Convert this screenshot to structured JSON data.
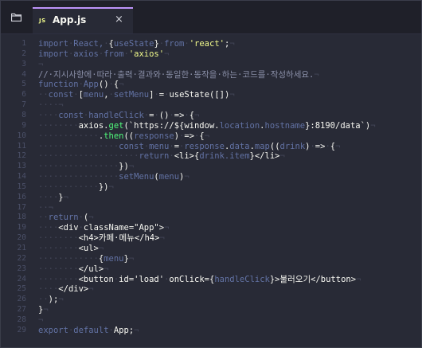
{
  "tab": {
    "js_badge": "JS",
    "file_name": "App.js",
    "close_glyph": "×"
  },
  "code_lines": [
    {
      "num": "1",
      "segments": [
        [
          "kw",
          "import"
        ],
        [
          "ws",
          "·"
        ],
        [
          "kw",
          "React,"
        ],
        [
          "ws",
          "·"
        ],
        [
          "pn",
          "{"
        ],
        [
          "kw",
          "useState"
        ],
        [
          "pn",
          "}"
        ],
        [
          "ws",
          "·"
        ],
        [
          "kw",
          "from"
        ],
        [
          "ws",
          "·"
        ],
        [
          "st",
          "'react'"
        ],
        [
          "pn",
          ";"
        ],
        [
          "ws",
          "¬"
        ]
      ]
    },
    {
      "num": "2",
      "segments": [
        [
          "kw",
          "import"
        ],
        [
          "ws",
          "·"
        ],
        [
          "kw",
          "axios"
        ],
        [
          "ws",
          "·"
        ],
        [
          "kw",
          "from"
        ],
        [
          "ws",
          "·"
        ],
        [
          "st",
          "'axios'"
        ],
        [
          "ws",
          "¬"
        ]
      ]
    },
    {
      "num": "3",
      "segments": [
        [
          "ws",
          "¬"
        ]
      ]
    },
    {
      "num": "4",
      "segments": [
        [
          "cm",
          "//·지시사항에·따라·출력·결과와·동일한·동작을·하는·코드를·작성하세요."
        ],
        [
          "ws",
          "¬"
        ]
      ]
    },
    {
      "num": "5",
      "segments": [
        [
          "kw",
          "function"
        ],
        [
          "ws",
          "·"
        ],
        [
          "kw",
          "App"
        ],
        [
          "pn",
          "()"
        ],
        [
          "ws",
          "·"
        ],
        [
          "pn",
          "{"
        ],
        [
          "ws",
          "¬"
        ]
      ]
    },
    {
      "num": "6",
      "segments": [
        [
          "ws",
          "··"
        ],
        [
          "kw",
          "const"
        ],
        [
          "ws",
          "·"
        ],
        [
          "pn",
          "["
        ],
        [
          "kw",
          "menu"
        ],
        [
          "pn",
          ","
        ],
        [
          "ws",
          "·"
        ],
        [
          "kw",
          "setMenu"
        ],
        [
          "pn",
          "]"
        ],
        [
          "ws",
          "·"
        ],
        [
          "pn",
          "="
        ],
        [
          "ws",
          "·"
        ],
        [
          "pn",
          "useState([])"
        ],
        [
          "ws",
          "¬"
        ]
      ]
    },
    {
      "num": "7",
      "segments": [
        [
          "ws",
          "····¬"
        ]
      ]
    },
    {
      "num": "8",
      "segments": [
        [
          "ws",
          "····"
        ],
        [
          "kw",
          "const"
        ],
        [
          "ws",
          "·"
        ],
        [
          "kw",
          "handleClick"
        ],
        [
          "ws",
          "·"
        ],
        [
          "pn",
          "="
        ],
        [
          "ws",
          "·"
        ],
        [
          "pn",
          "()"
        ],
        [
          "ws",
          "·"
        ],
        [
          "pn",
          "=>"
        ],
        [
          "ws",
          "·"
        ],
        [
          "pn",
          "{"
        ],
        [
          "ws",
          "¬"
        ]
      ]
    },
    {
      "num": "9",
      "segments": [
        [
          "ws",
          "········"
        ],
        [
          "pn",
          "axios."
        ],
        [
          "fn",
          "get"
        ],
        [
          "pn",
          "(`https://${window."
        ],
        [
          "kw",
          "location"
        ],
        [
          "pn",
          "."
        ],
        [
          "kw",
          "hostname"
        ],
        [
          "pn",
          "}:8190/data`)"
        ],
        [
          "ws",
          "¬"
        ]
      ]
    },
    {
      "num": "10",
      "segments": [
        [
          "ws",
          "············"
        ],
        [
          "pn",
          "."
        ],
        [
          "fn",
          "then"
        ],
        [
          "pn",
          "(("
        ],
        [
          "kw",
          "response"
        ],
        [
          "pn",
          ")"
        ],
        [
          "ws",
          "·"
        ],
        [
          "pn",
          "=>"
        ],
        [
          "ws",
          "·"
        ],
        [
          "pn",
          "{"
        ],
        [
          "ws",
          "¬"
        ]
      ]
    },
    {
      "num": "11",
      "segments": [
        [
          "ws",
          "················"
        ],
        [
          "kw",
          "const"
        ],
        [
          "ws",
          "·"
        ],
        [
          "kw",
          "menu"
        ],
        [
          "ws",
          "·"
        ],
        [
          "pn",
          "="
        ],
        [
          "ws",
          "·"
        ],
        [
          "kw",
          "response"
        ],
        [
          "pn",
          "."
        ],
        [
          "kw",
          "data"
        ],
        [
          "pn",
          "."
        ],
        [
          "kw",
          "map"
        ],
        [
          "pn",
          "(("
        ],
        [
          "kw",
          "drink"
        ],
        [
          "pn",
          ")"
        ],
        [
          "ws",
          "·"
        ],
        [
          "pn",
          "=>"
        ],
        [
          "ws",
          "·"
        ],
        [
          "pn",
          "{"
        ],
        [
          "ws",
          "¬"
        ]
      ]
    },
    {
      "num": "12",
      "segments": [
        [
          "ws",
          "····················"
        ],
        [
          "kw",
          "return"
        ],
        [
          "ws",
          "·"
        ],
        [
          "pn",
          "<li>{"
        ],
        [
          "kw",
          "drink.item"
        ],
        [
          "pn",
          "}</li>"
        ],
        [
          "ws",
          "¬"
        ]
      ]
    },
    {
      "num": "13",
      "segments": [
        [
          "ws",
          "················"
        ],
        [
          "pn",
          "})"
        ],
        [
          "ws",
          "¬"
        ]
      ]
    },
    {
      "num": "14",
      "segments": [
        [
          "ws",
          "················"
        ],
        [
          "kw",
          "setMenu"
        ],
        [
          "pn",
          "("
        ],
        [
          "kw",
          "menu"
        ],
        [
          "pn",
          ")"
        ],
        [
          "ws",
          "¬"
        ]
      ]
    },
    {
      "num": "15",
      "segments": [
        [
          "ws",
          "············"
        ],
        [
          "pn",
          "})"
        ],
        [
          "ws",
          "¬"
        ]
      ]
    },
    {
      "num": "16",
      "segments": [
        [
          "ws",
          "····"
        ],
        [
          "pn",
          "}"
        ],
        [
          "ws",
          "¬"
        ]
      ]
    },
    {
      "num": "17",
      "segments": [
        [
          "ws",
          "··¬"
        ]
      ]
    },
    {
      "num": "18",
      "segments": [
        [
          "ws",
          "··"
        ],
        [
          "kw",
          "return"
        ],
        [
          "ws",
          "·"
        ],
        [
          "pn",
          "("
        ],
        [
          "ws",
          "¬"
        ]
      ]
    },
    {
      "num": "19",
      "segments": [
        [
          "ws",
          "····"
        ],
        [
          "pn",
          "<div"
        ],
        [
          "ws",
          "·"
        ],
        [
          "pn",
          "className=\"App\">"
        ],
        [
          "ws",
          "¬"
        ]
      ]
    },
    {
      "num": "20",
      "segments": [
        [
          "ws",
          "········"
        ],
        [
          "pn",
          "<h4>카페·메뉴</h4>"
        ],
        [
          "ws",
          "¬"
        ]
      ]
    },
    {
      "num": "21",
      "segments": [
        [
          "ws",
          "········"
        ],
        [
          "pn",
          "<ul>"
        ],
        [
          "ws",
          "¬"
        ]
      ]
    },
    {
      "num": "22",
      "segments": [
        [
          "ws",
          "············"
        ],
        [
          "pn",
          "{"
        ],
        [
          "kw",
          "menu"
        ],
        [
          "pn",
          "}"
        ],
        [
          "ws",
          "¬"
        ]
      ]
    },
    {
      "num": "23",
      "segments": [
        [
          "ws",
          "········"
        ],
        [
          "pn",
          "</ul>"
        ],
        [
          "ws",
          "¬"
        ]
      ]
    },
    {
      "num": "24",
      "segments": [
        [
          "ws",
          "········"
        ],
        [
          "pn",
          "<button"
        ],
        [
          "ws",
          "·"
        ],
        [
          "pn",
          "id='load'"
        ],
        [
          "ws",
          "·"
        ],
        [
          "pn",
          "onClick={"
        ],
        [
          "kw",
          "handleClick"
        ],
        [
          "pn",
          "}>불러오기</button>"
        ],
        [
          "ws",
          "¬"
        ]
      ]
    },
    {
      "num": "25",
      "segments": [
        [
          "ws",
          "····"
        ],
        [
          "pn",
          "</div>"
        ],
        [
          "ws",
          "¬"
        ]
      ]
    },
    {
      "num": "26",
      "segments": [
        [
          "ws",
          "··"
        ],
        [
          "pn",
          ");"
        ],
        [
          "ws",
          "¬"
        ]
      ]
    },
    {
      "num": "27",
      "segments": [
        [
          "pn",
          "}"
        ],
        [
          "ws",
          "¬"
        ]
      ]
    },
    {
      "num": "28",
      "segments": [
        [
          "ws",
          "¬"
        ]
      ]
    },
    {
      "num": "29",
      "segments": [
        [
          "kw",
          "export"
        ],
        [
          "ws",
          "·"
        ],
        [
          "kw",
          "default"
        ],
        [
          "ws",
          "·"
        ],
        [
          "pn",
          "App;"
        ],
        [
          "ws",
          "¬"
        ]
      ]
    }
  ]
}
